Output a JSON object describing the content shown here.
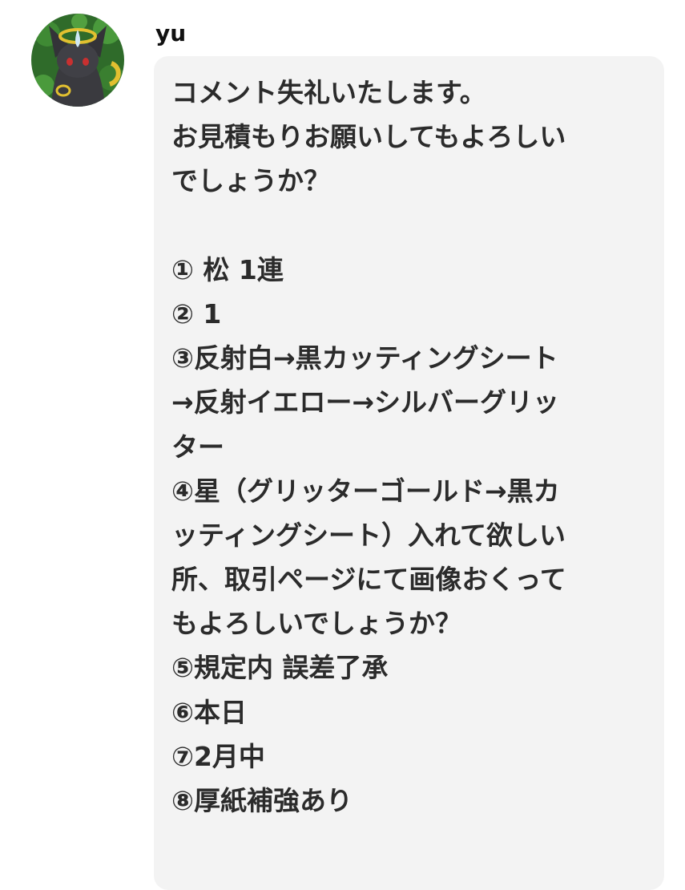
{
  "comment": {
    "username": "yu",
    "avatar_icon": "dark-fox-creature-avatar-icon",
    "bubble_color": "#f3f3f3",
    "lines": [
      "コメント失礼いたします。",
      "お見積もりお願いしてもよろしい",
      "でしょうか？",
      "",
      "① 松 1連",
      "② 1",
      "③反射白→黒カッティングシート",
      "→反射イエロー→シルバーグリッ",
      "ター",
      "④星（グリッターゴールド→黒カ",
      "ッティングシート）入れて欲しい",
      "所、取引ページにて画像おくって",
      "もよろしいでしょうか？",
      "⑤規定内 誤差了承",
      "⑥本日",
      "⑦2月中",
      "⑧厚紙補強あり"
    ]
  }
}
